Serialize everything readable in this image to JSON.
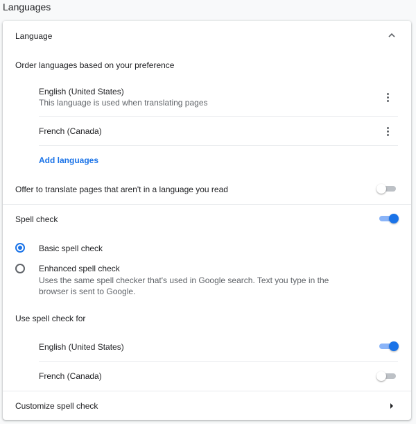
{
  "section_title": "Languages",
  "language": {
    "header": "Language",
    "order_label": "Order languages based on your preference",
    "items": [
      {
        "name": "English (United States)",
        "subtitle": "This language is used when translating pages"
      },
      {
        "name": "French (Canada)"
      }
    ],
    "add_link": "Add languages",
    "offer_translate": {
      "label": "Offer to translate pages that aren't in a language you read",
      "enabled": false
    }
  },
  "spell_check": {
    "label": "Spell check",
    "enabled": true,
    "options": [
      {
        "label": "Basic spell check",
        "selected": true
      },
      {
        "label": "Enhanced spell check",
        "description_line1": "Uses the same spell checker that's used in Google search. Text you type in the",
        "description_line2": "browser is sent to Google.",
        "selected": false
      }
    ],
    "use_for_label": "Use spell check for",
    "languages": [
      {
        "name": "English (United States)",
        "enabled": true
      },
      {
        "name": "French (Canada)",
        "enabled": false
      }
    ],
    "customize_label": "Customize spell check"
  },
  "icons": {
    "collapse": "chevron-up-icon",
    "more": "more-vert-icon",
    "navigate": "arrow-right-icon"
  },
  "colors": {
    "accent": "#1a73e8",
    "toggle_on_track": "#8ab4f8",
    "toggle_off_track": "#bdc1c6"
  }
}
